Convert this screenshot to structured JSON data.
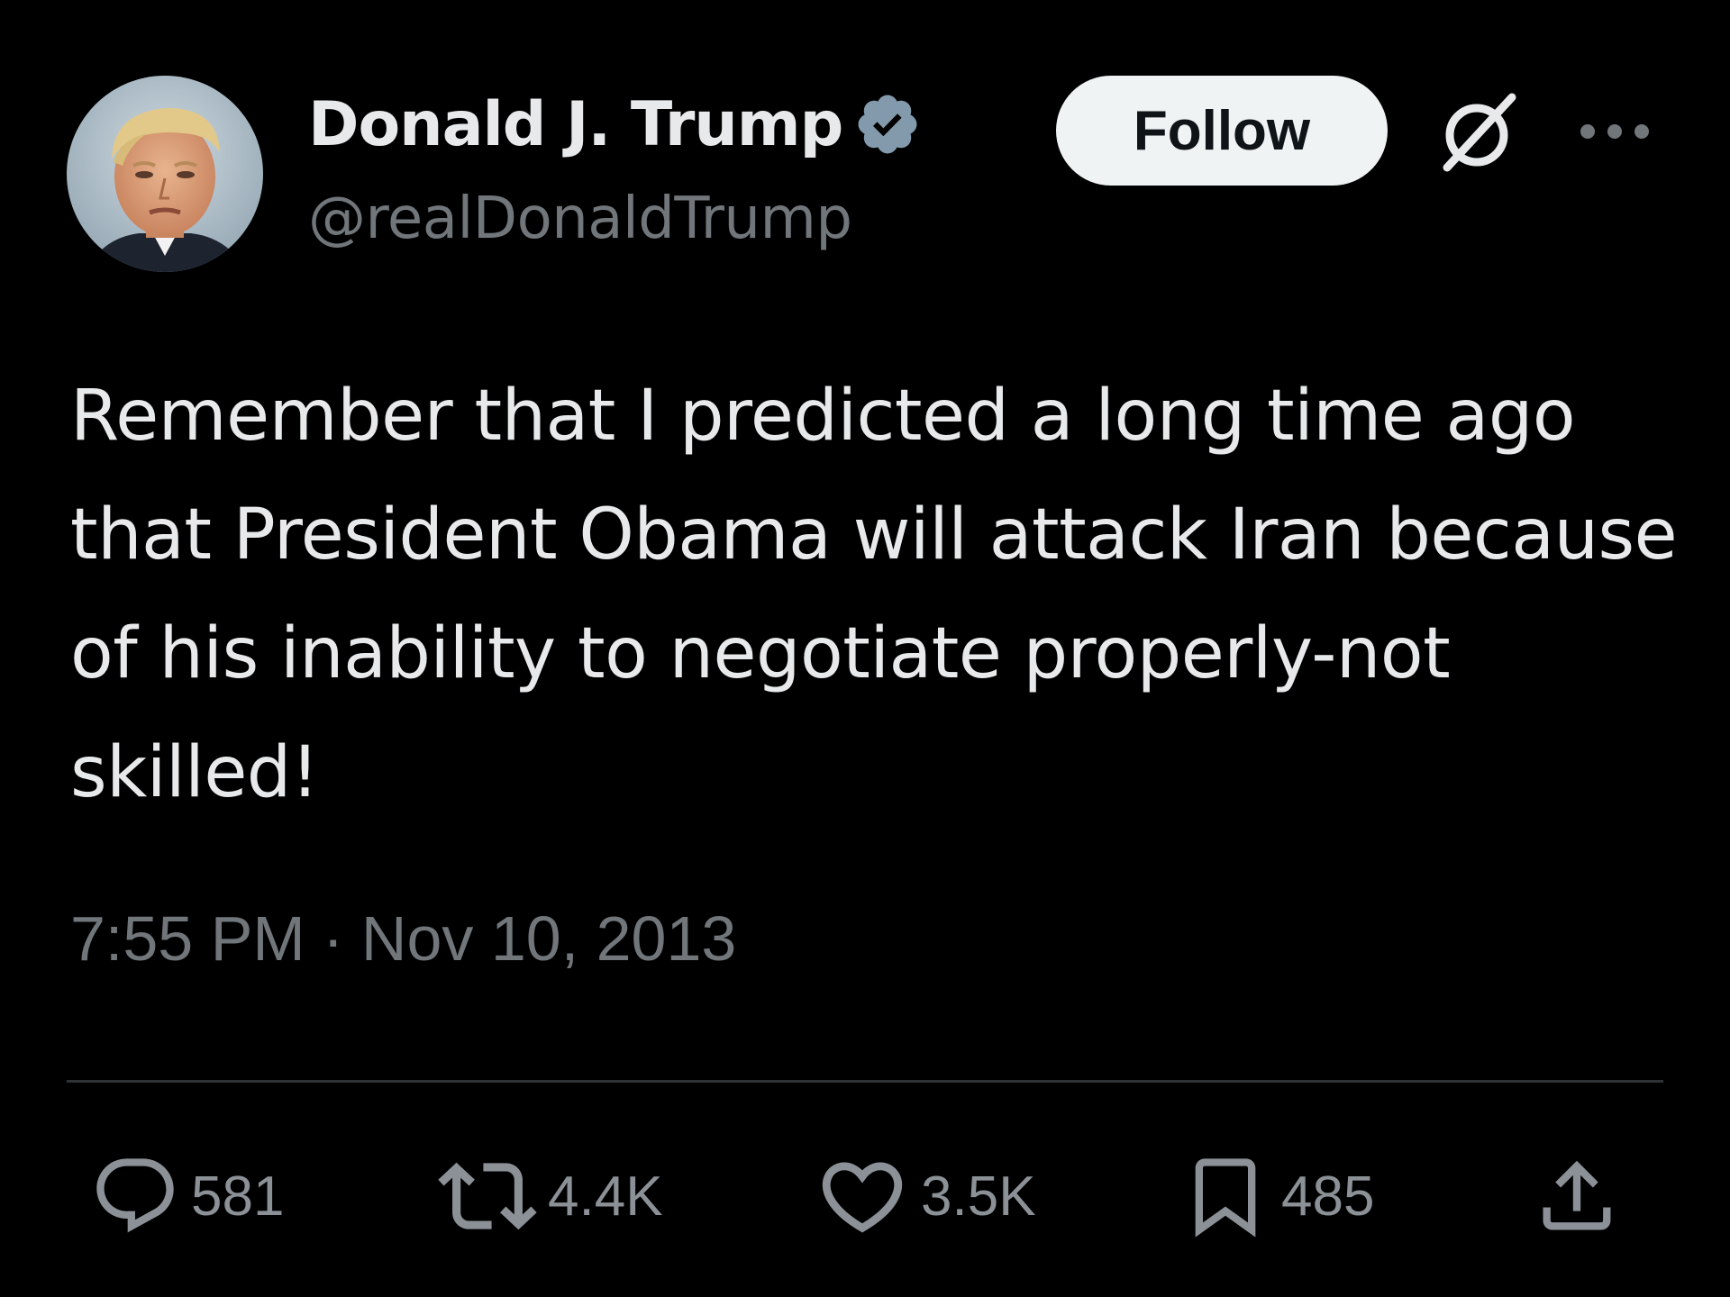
{
  "author": {
    "display_name": "Donald J. Trump",
    "handle": "@realDonaldTrump",
    "verified": true,
    "verified_color": "#829aab"
  },
  "header": {
    "follow_label": "Follow",
    "icons": [
      "grok-icon",
      "more-icon"
    ]
  },
  "tweet": {
    "text": "Remember that I predicted a long time ago that President Obama will attack Iran because of his inability to negotiate properly-not skilled!",
    "timestamp": "7:55 PM · Nov 10, 2013"
  },
  "stats": {
    "replies": "581",
    "reposts": "4.4K",
    "likes": "3.5K",
    "bookmarks": "485"
  },
  "colors": {
    "background": "#000000",
    "text_primary": "#e7e9ea",
    "text_secondary": "#71767b",
    "divider": "#2f3336",
    "follow_bg": "#eff3f4"
  }
}
